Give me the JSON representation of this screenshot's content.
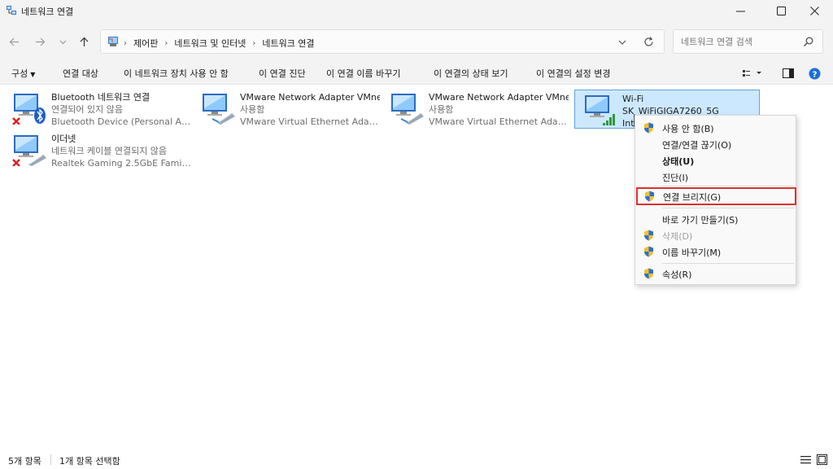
{
  "window": {
    "title": "네트워크 연결"
  },
  "address": {
    "crumbs": [
      "제어판",
      "네트워크 및 인터넷",
      "네트워크 연결"
    ]
  },
  "search": {
    "placeholder": "네트워크 연결 검색"
  },
  "commandbar": {
    "organize": "구성",
    "items": [
      "연결 대상",
      "이 네트워크 장치 사용 안 함",
      "이 연결 진단",
      "이 연결 이름 바꾸기",
      "이 연결의 상태 보기",
      "이 연결의 설정 변경"
    ]
  },
  "connections": [
    {
      "name": "Bluetooth 네트워크 연결",
      "status": "연결되어 있지 않음",
      "device": "Bluetooth Device (Personal Area ...",
      "icon": "bluetooth-adapter-icon",
      "disconnected": true
    },
    {
      "name": "VMware Network Adapter VMnet1",
      "status": "사용함",
      "device": "VMware Virtual Ethernet Adapter...",
      "icon": "ethernet-adapter-icon",
      "disconnected": false
    },
    {
      "name": "VMware Network Adapter VMnet8",
      "status": "사용함",
      "device": "VMware Virtual Ethernet Adapter...",
      "icon": "ethernet-adapter-icon",
      "disconnected": false
    },
    {
      "name": "Wi-Fi",
      "status": "SK_WiFiGIGA7260_5G",
      "device": "Intel",
      "icon": "wifi-adapter-icon",
      "disconnected": false,
      "selected": true
    },
    {
      "name": "이더넷",
      "status": "네트워크 케이블 연결되지 않음",
      "device": "Realtek Gaming 2.5GbE Family C...",
      "icon": "ethernet-adapter-icon",
      "disconnected": true
    }
  ],
  "context_menu": {
    "items": [
      {
        "label": "사용 안 함(B)",
        "shield": true
      },
      {
        "label": "연결/연결 끊기(O)",
        "shield": false
      },
      {
        "label": "상태(U)",
        "shield": false,
        "bold": true
      },
      {
        "label": "진단(I)",
        "shield": false
      },
      {
        "label": "연결 브리지(G)",
        "shield": true,
        "highlighted": true
      },
      {
        "label": "바로 가기 만들기(S)",
        "shield": false
      },
      {
        "label": "삭제(D)",
        "shield": true,
        "disabled": true
      },
      {
        "label": "이름 바꾸기(M)",
        "shield": true
      },
      {
        "label": "속성(R)",
        "shield": true
      }
    ]
  },
  "statusbar": {
    "count": "5개 항목",
    "selected": "1개 항목 선택함"
  },
  "colors": {
    "selection": "#cce8ff",
    "selection_border": "#5fa4dc",
    "highlight_border": "#d9332e",
    "help": "#1e6fd9"
  }
}
